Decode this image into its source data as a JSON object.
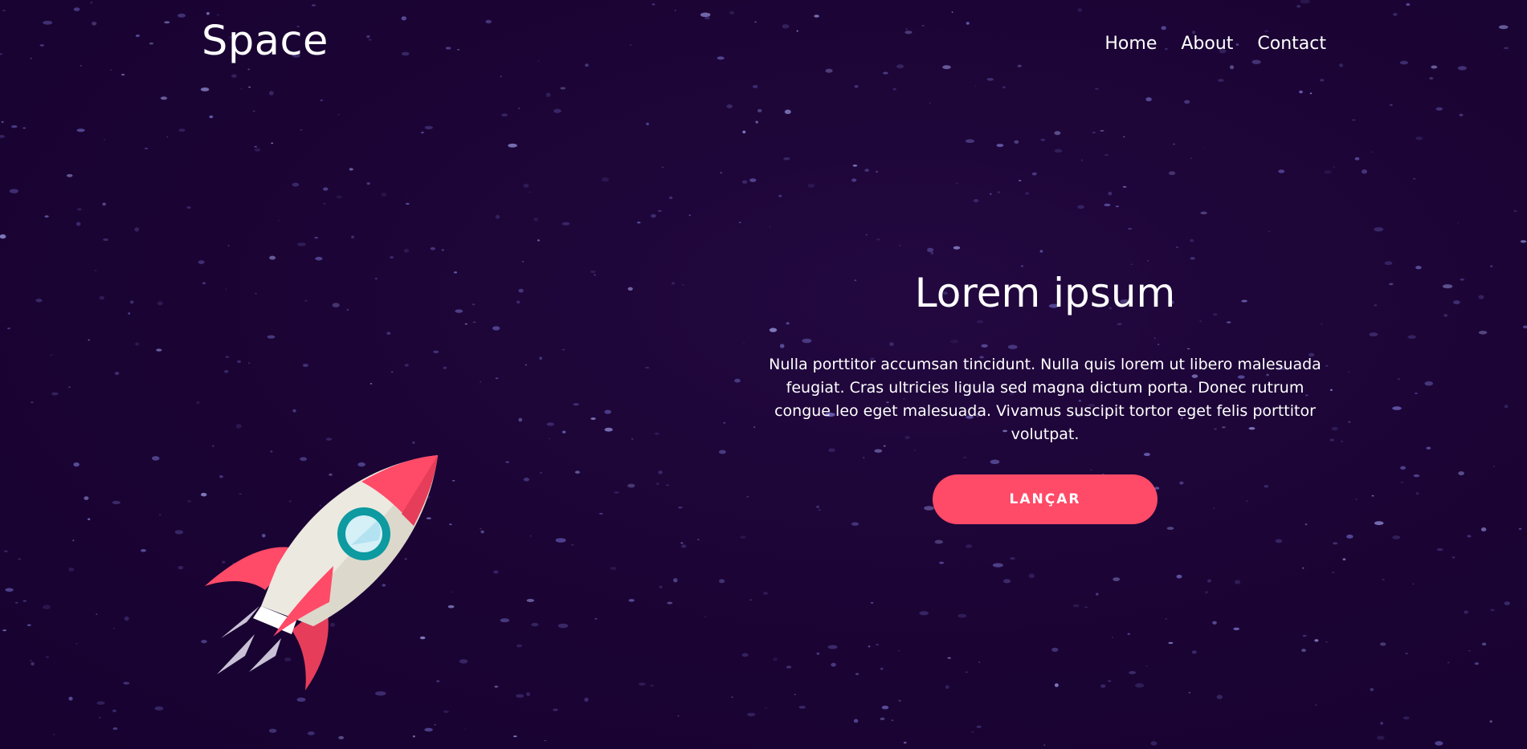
{
  "header": {
    "brand": "Space",
    "nav": [
      {
        "label": "Home"
      },
      {
        "label": "About"
      },
      {
        "label": "Contact"
      }
    ]
  },
  "hero": {
    "title": "Lorem ipsum",
    "description": "Nulla porttitor accumsan tincidunt. Nulla quis lorem ut libero malesuada feugiat. Cras ultricies ligula sed magna dictum porta. Donec rutrum congue leo eget malesuada. Vivamus suscipit tortor eget felis porttitor volutpat.",
    "cta_label": "LANÇAR",
    "illustration": "rocket-icon"
  },
  "colors": {
    "background": "#1b0434",
    "accent": "#ff4a68",
    "text": "#ffffff"
  }
}
